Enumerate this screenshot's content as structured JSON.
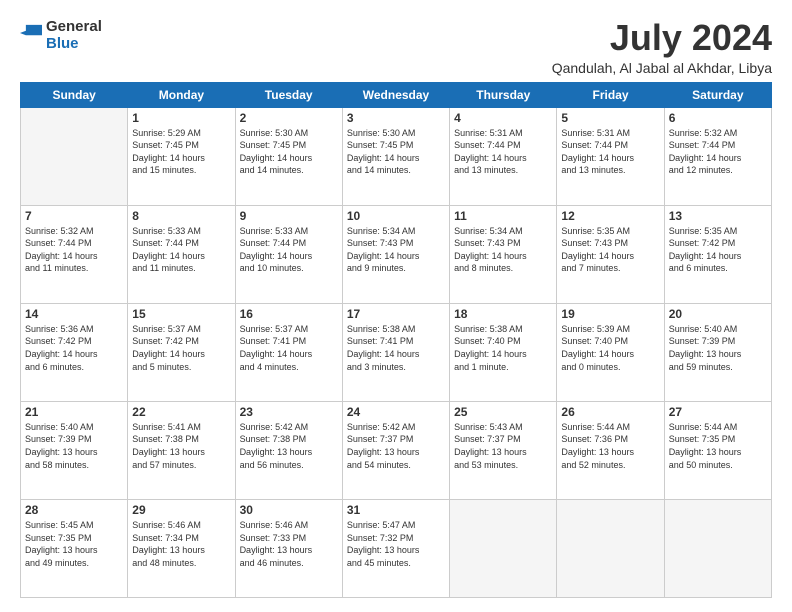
{
  "logo": {
    "line1": "General",
    "line2": "Blue"
  },
  "title": "July 2024",
  "subtitle": "Qandulah, Al Jabal al Akhdar, Libya",
  "weekdays": [
    "Sunday",
    "Monday",
    "Tuesday",
    "Wednesday",
    "Thursday",
    "Friday",
    "Saturday"
  ],
  "weeks": [
    [
      {
        "day": "",
        "empty": true
      },
      {
        "day": "1",
        "sunrise": "5:29 AM",
        "sunset": "7:45 PM",
        "daylight": "14 hours and 15 minutes."
      },
      {
        "day": "2",
        "sunrise": "5:30 AM",
        "sunset": "7:45 PM",
        "daylight": "14 hours and 14 minutes."
      },
      {
        "day": "3",
        "sunrise": "5:30 AM",
        "sunset": "7:45 PM",
        "daylight": "14 hours and 14 minutes."
      },
      {
        "day": "4",
        "sunrise": "5:31 AM",
        "sunset": "7:44 PM",
        "daylight": "14 hours and 13 minutes."
      },
      {
        "day": "5",
        "sunrise": "5:31 AM",
        "sunset": "7:44 PM",
        "daylight": "14 hours and 13 minutes."
      },
      {
        "day": "6",
        "sunrise": "5:32 AM",
        "sunset": "7:44 PM",
        "daylight": "14 hours and 12 minutes."
      }
    ],
    [
      {
        "day": "7",
        "sunrise": "5:32 AM",
        "sunset": "7:44 PM",
        "daylight": "14 hours and 11 minutes."
      },
      {
        "day": "8",
        "sunrise": "5:33 AM",
        "sunset": "7:44 PM",
        "daylight": "14 hours and 11 minutes."
      },
      {
        "day": "9",
        "sunrise": "5:33 AM",
        "sunset": "7:44 PM",
        "daylight": "14 hours and 10 minutes."
      },
      {
        "day": "10",
        "sunrise": "5:34 AM",
        "sunset": "7:43 PM",
        "daylight": "14 hours and 9 minutes."
      },
      {
        "day": "11",
        "sunrise": "5:34 AM",
        "sunset": "7:43 PM",
        "daylight": "14 hours and 8 minutes."
      },
      {
        "day": "12",
        "sunrise": "5:35 AM",
        "sunset": "7:43 PM",
        "daylight": "14 hours and 7 minutes."
      },
      {
        "day": "13",
        "sunrise": "5:35 AM",
        "sunset": "7:42 PM",
        "daylight": "14 hours and 6 minutes."
      }
    ],
    [
      {
        "day": "14",
        "sunrise": "5:36 AM",
        "sunset": "7:42 PM",
        "daylight": "14 hours and 6 minutes."
      },
      {
        "day": "15",
        "sunrise": "5:37 AM",
        "sunset": "7:42 PM",
        "daylight": "14 hours and 5 minutes."
      },
      {
        "day": "16",
        "sunrise": "5:37 AM",
        "sunset": "7:41 PM",
        "daylight": "14 hours and 4 minutes."
      },
      {
        "day": "17",
        "sunrise": "5:38 AM",
        "sunset": "7:41 PM",
        "daylight": "14 hours and 3 minutes."
      },
      {
        "day": "18",
        "sunrise": "5:38 AM",
        "sunset": "7:40 PM",
        "daylight": "14 hours and 1 minute."
      },
      {
        "day": "19",
        "sunrise": "5:39 AM",
        "sunset": "7:40 PM",
        "daylight": "14 hours and 0 minutes."
      },
      {
        "day": "20",
        "sunrise": "5:40 AM",
        "sunset": "7:39 PM",
        "daylight": "13 hours and 59 minutes."
      }
    ],
    [
      {
        "day": "21",
        "sunrise": "5:40 AM",
        "sunset": "7:39 PM",
        "daylight": "13 hours and 58 minutes."
      },
      {
        "day": "22",
        "sunrise": "5:41 AM",
        "sunset": "7:38 PM",
        "daylight": "13 hours and 57 minutes."
      },
      {
        "day": "23",
        "sunrise": "5:42 AM",
        "sunset": "7:38 PM",
        "daylight": "13 hours and 56 minutes."
      },
      {
        "day": "24",
        "sunrise": "5:42 AM",
        "sunset": "7:37 PM",
        "daylight": "13 hours and 54 minutes."
      },
      {
        "day": "25",
        "sunrise": "5:43 AM",
        "sunset": "7:37 PM",
        "daylight": "13 hours and 53 minutes."
      },
      {
        "day": "26",
        "sunrise": "5:44 AM",
        "sunset": "7:36 PM",
        "daylight": "13 hours and 52 minutes."
      },
      {
        "day": "27",
        "sunrise": "5:44 AM",
        "sunset": "7:35 PM",
        "daylight": "13 hours and 50 minutes."
      }
    ],
    [
      {
        "day": "28",
        "sunrise": "5:45 AM",
        "sunset": "7:35 PM",
        "daylight": "13 hours and 49 minutes."
      },
      {
        "day": "29",
        "sunrise": "5:46 AM",
        "sunset": "7:34 PM",
        "daylight": "13 hours and 48 minutes."
      },
      {
        "day": "30",
        "sunrise": "5:46 AM",
        "sunset": "7:33 PM",
        "daylight": "13 hours and 46 minutes."
      },
      {
        "day": "31",
        "sunrise": "5:47 AM",
        "sunset": "7:32 PM",
        "daylight": "13 hours and 45 minutes."
      },
      {
        "day": "",
        "empty": true
      },
      {
        "day": "",
        "empty": true
      },
      {
        "day": "",
        "empty": true
      }
    ]
  ],
  "labels": {
    "sunrise": "Sunrise:",
    "sunset": "Sunset:",
    "daylight": "Daylight:"
  }
}
